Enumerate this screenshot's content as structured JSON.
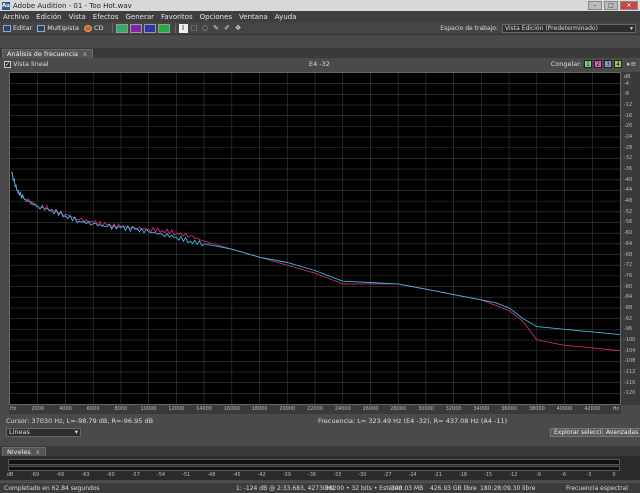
{
  "window": {
    "app_title": "Adobe Audition - 01 - Too Hot.wav",
    "icon_label": "Au"
  },
  "menu": [
    "Archivo",
    "Edición",
    "Vista",
    "Efectos",
    "Generar",
    "Favoritos",
    "Opciones",
    "Ventana",
    "Ayuda"
  ],
  "toolbar": {
    "editar": "Editar",
    "multipista": "Multipista",
    "cd": "CD",
    "workspace_label": "Espacio de trabajo:",
    "workspace_value": "Vista Edición (Predeterminado)"
  },
  "panel": {
    "tab_label": "Análisis de frecuencia",
    "close": "x",
    "linear_label": "Vista lineal",
    "linear_checked": "✓",
    "cursor_note": "E4 -32",
    "freeze_label": "Congelar:",
    "freeze_buttons": [
      "1",
      "2",
      "3",
      "4"
    ]
  },
  "info": {
    "cursor": "Cursor:   37030 Hz, L=-98.79 dB, R=-96.95 dB",
    "frequency": "Frecuencia:     L= 323.49 Hz (E4 -32), R= 437.08 Hz (A4 -11)",
    "scale_select": "Líneas",
    "explore_button": "Explorar selección",
    "advanced_button": "Avanzadas"
  },
  "levels": {
    "tab_label": "Niveles",
    "close": "x",
    "scale": [
      "dB",
      "-69",
      "-66",
      "-63",
      "-60",
      "-57",
      "-54",
      "-51",
      "-48",
      "-45",
      "-42",
      "-39",
      "-36",
      "-33",
      "-30",
      "-27",
      "-24",
      "-21",
      "-18",
      "-15",
      "-12",
      "-9",
      "-6",
      "-3",
      "0"
    ]
  },
  "statusbar": {
    "completed": "Completado en 62.84 segundos",
    "peak": "1: -124 dB @  2:33.683, 42730Hz",
    "format": "88200 • 32 bits • Estéreo",
    "size": "300.03 MB",
    "free": "426.93 GB libre",
    "free_time": "180:28:09.30 libre",
    "view": "Frecuencia espectral"
  },
  "chart_data": {
    "type": "line",
    "xlabel": "Hz",
    "ylabel": "dB",
    "xlim": [
      0,
      44000
    ],
    "ylim": [
      -124,
      0
    ],
    "x_ticks": [
      2000,
      4000,
      6000,
      8000,
      10000,
      12000,
      14000,
      16000,
      18000,
      20000,
      22000,
      24000,
      26000,
      28000,
      30000,
      32000,
      34000,
      36000,
      38000,
      40000,
      42000
    ],
    "y_ticks": [
      -4,
      -8,
      -12,
      -16,
      -20,
      -24,
      -28,
      -32,
      -36,
      -40,
      -44,
      -48,
      -52,
      -56,
      -60,
      -64,
      -68,
      -72,
      -76,
      -80,
      -84,
      -88,
      -92,
      -96,
      -100,
      -104,
      -108,
      -112,
      -116,
      -120
    ],
    "grid": true,
    "series": [
      {
        "color": "#d02878",
        "x": [
          100,
          500,
          1000,
          2000,
          3000,
          4000,
          5000,
          6000,
          7000,
          8000,
          9000,
          10000,
          11000,
          12000,
          13000,
          14000,
          16000,
          18000,
          20000,
          22000,
          23000,
          24000,
          26000,
          28000,
          30000,
          32000,
          34000,
          35000,
          36000,
          37000,
          38000,
          40000,
          42000,
          44000
        ],
        "y": [
          -37,
          -44,
          -47,
          -50,
          -51,
          -53,
          -55,
          -56,
          -57,
          -57.5,
          -58,
          -58.5,
          -59,
          -60,
          -61,
          -63,
          -66,
          -69,
          -72,
          -75,
          -77,
          -79,
          -79,
          -79,
          -81,
          -83,
          -85,
          -87,
          -89,
          -93,
          -100,
          -102,
          -103,
          -104
        ]
      },
      {
        "color": "#38b8d8",
        "x": [
          100,
          500,
          1000,
          2000,
          3000,
          4000,
          5000,
          6000,
          7000,
          8000,
          9000,
          10000,
          11000,
          12000,
          13000,
          14000,
          16000,
          18000,
          20000,
          22000,
          23000,
          24000,
          26000,
          28000,
          30000,
          32000,
          34000,
          35000,
          36000,
          37000,
          38000,
          40000,
          42000,
          44000
        ],
        "y": [
          -37,
          -44,
          -47,
          -50,
          -51.5,
          -53.5,
          -55.5,
          -56.5,
          -57.5,
          -58,
          -58.5,
          -59.5,
          -60.5,
          -61.5,
          -63,
          -64,
          -66,
          -69,
          -71,
          -74,
          -76,
          -78,
          -78.5,
          -79,
          -81,
          -83,
          -85,
          -86,
          -88,
          -92,
          -95,
          -96,
          -97,
          -98
        ]
      }
    ]
  }
}
